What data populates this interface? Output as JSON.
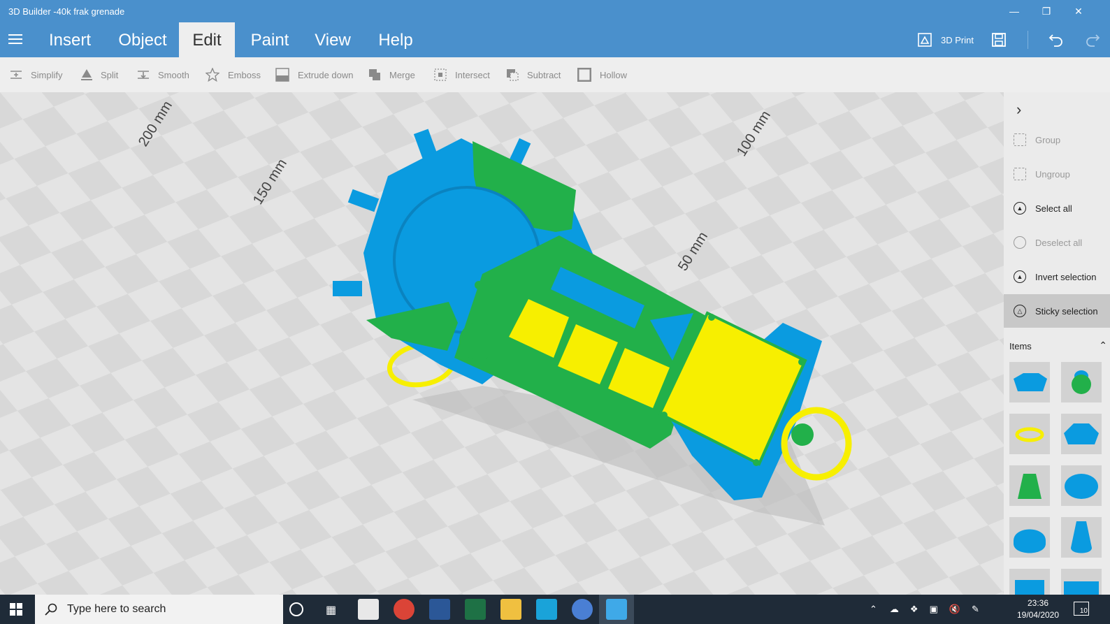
{
  "window": {
    "title": "3D Builder -40k frak grenade"
  },
  "menu": {
    "tabs": [
      "Insert",
      "Object",
      "Edit",
      "Paint",
      "View",
      "Help"
    ],
    "active": "Edit",
    "print_label": "3D Print"
  },
  "toolbar": {
    "tools": [
      "Simplify",
      "Split",
      "Smooth",
      "Emboss",
      "Extrude down",
      "Merge",
      "Intersect",
      "Subtract",
      "Hollow"
    ]
  },
  "viewport": {
    "dimensions": [
      "200 mm",
      "150 mm",
      "100 mm",
      "50 mm"
    ],
    "colors": {
      "blue": "#0a9be0",
      "green": "#22b04a",
      "yellow": "#f7ef00"
    }
  },
  "sidepanel": {
    "actions": [
      "Group",
      "Ungroup",
      "Select all",
      "Deselect all",
      "Invert selection",
      "Sticky selection"
    ],
    "items_label": "Items"
  },
  "taskbar": {
    "search_placeholder": "Type here to search",
    "time": "23:36",
    "date": "19/04/2020",
    "notifications": "10"
  }
}
